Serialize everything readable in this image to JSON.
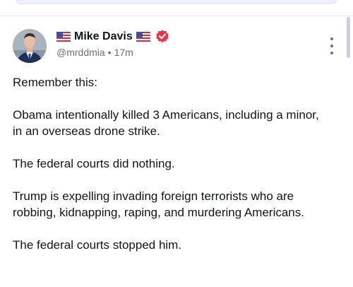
{
  "post": {
    "author_name": "Mike Davis",
    "handle": "@mrddmia",
    "separator": "•",
    "time_ago": "17m",
    "verified": true,
    "name_flag_icon": "us-flag-icon",
    "paragraphs": [
      "Remember this:",
      "Obama intentionally killed 3 Americans, including a minor, in an overseas drone strike.",
      "The federal courts did nothing.",
      "Trump is expelling invading foreign terrorists who are robbing, kidnapping, raping, and murdering Americans.",
      "The federal courts stopped him."
    ]
  },
  "colors": {
    "verified_badge": "#e8374b",
    "meta_text": "#6b6f76",
    "scrollbar": "#c9cde6"
  }
}
